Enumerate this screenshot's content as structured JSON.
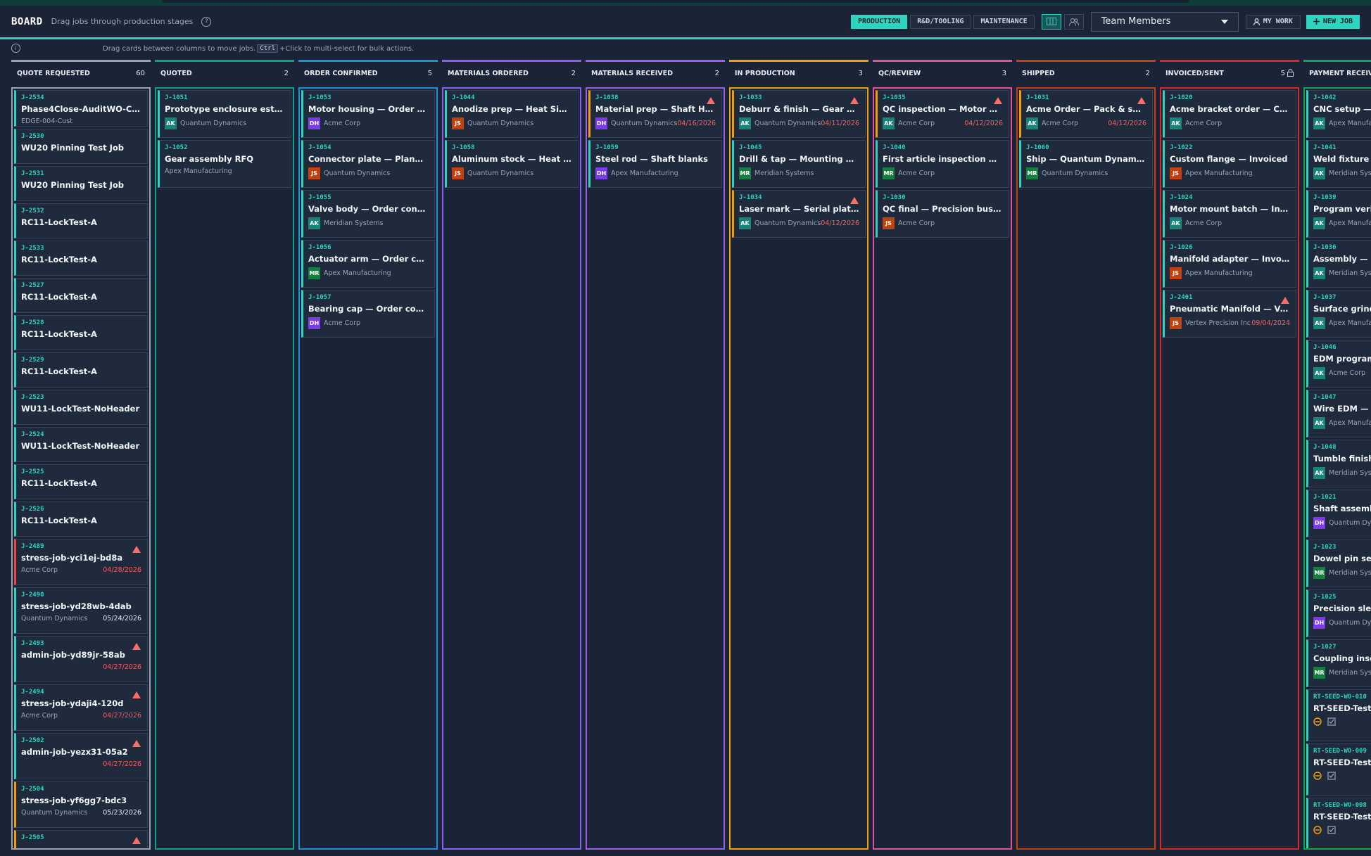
{
  "header": {
    "title": "BOARD",
    "subtitle": "Drag jobs through production stages",
    "help_icon": "question-circle-icon",
    "tabs": [
      {
        "label": "PRODUCTION",
        "active": true
      },
      {
        "label": "R&D/TOOLING",
        "active": false
      },
      {
        "label": "MAINTENANCE",
        "active": false
      }
    ],
    "team_select": "Team Members",
    "my_work": "MY WORK",
    "new_job": "NEW JOB",
    "accent": "#2dd4bf"
  },
  "hint": {
    "before": "Drag cards between columns to move jobs.",
    "key": "Ctrl",
    "after": "+Click to multi-select for bulk actions."
  },
  "avatars": {
    "AK": "#17857a",
    "DH": "#7c3aed",
    "JS": "#c2410c",
    "MR": "#15803d"
  },
  "columns": [
    {
      "title": "QUOTE REQUESTED",
      "count": "60",
      "color": "#9ca3af",
      "cards": [
        {
          "id": "J-2534",
          "title": "Phase4Close-AuditWO-Create",
          "cust": "EDGE-004-Cust",
          "bar": "#2dd4bf"
        },
        {
          "id": "J-2530",
          "title": "WU20 Pinning Test Job",
          "bar": "#2dd4bf"
        },
        {
          "id": "J-2531",
          "title": "WU20 Pinning Test Job",
          "bar": "#2dd4bf"
        },
        {
          "id": "J-2532",
          "title": "RC11-LockTest-A",
          "bar": "#2dd4bf"
        },
        {
          "id": "J-2533",
          "title": "RC11-LockTest-A",
          "bar": "#2dd4bf"
        },
        {
          "id": "J-2527",
          "title": "RC11-LockTest-A",
          "bar": "#2dd4bf"
        },
        {
          "id": "J-2528",
          "title": "RC11-LockTest-A",
          "bar": "#2dd4bf"
        },
        {
          "id": "J-2529",
          "title": "RC11-LockTest-A",
          "bar": "#2dd4bf"
        },
        {
          "id": "J-2523",
          "title": "WU11-LockTest-NoHeader",
          "bar": "#2dd4bf"
        },
        {
          "id": "J-2524",
          "title": "WU11-LockTest-NoHeader",
          "bar": "#2dd4bf"
        },
        {
          "id": "J-2525",
          "title": "RC11-LockTest-A",
          "bar": "#2dd4bf"
        },
        {
          "id": "J-2526",
          "title": "RC11-LockTest-A",
          "bar": "#2dd4bf"
        },
        {
          "id": "J-2489",
          "title": "stress-job-yci1ej-bd8a",
          "cust": "Acme Corp",
          "date": "04/28/2026",
          "overdue": true,
          "warn": true,
          "bar": "#ef4444"
        },
        {
          "id": "J-2490",
          "title": "stress-job-yd28wb-4dab",
          "cust": "Quantum Dynamics",
          "date": "05/24/2026",
          "bar": "#2dd4bf"
        },
        {
          "id": "J-2493",
          "title": "admin-job-yd89jr-58ab",
          "date": "04/27/2026",
          "overdue": true,
          "warn": true,
          "bar": "#2dd4bf"
        },
        {
          "id": "J-2494",
          "title": "stress-job-ydaji4-120d",
          "cust": "Acme Corp",
          "date": "04/27/2026",
          "overdue": true,
          "warn": true,
          "bar": "#2dd4bf"
        },
        {
          "id": "J-2502",
          "title": "admin-job-yezx31-05a2",
          "date": "04/27/2026",
          "overdue": true,
          "warn": true,
          "bar": "#2dd4bf"
        },
        {
          "id": "J-2504",
          "title": "stress-job-yf6gg7-bdc3",
          "cust": "Quantum Dynamics",
          "date": "05/23/2026",
          "bar": "#f59e0b"
        },
        {
          "id": "J-2505",
          "title": "",
          "warn": true,
          "bar": "#f59e0b"
        }
      ]
    },
    {
      "title": "QUOTED",
      "count": "2",
      "color": "#0f9f8a",
      "cards": [
        {
          "id": "J-1051",
          "title": "Prototype enclosure estimate",
          "av": "AK",
          "cust": "Quantum Dynamics",
          "bar": "#2dd4bf"
        },
        {
          "id": "J-1052",
          "title": "Gear assembly RFQ",
          "cust": "Apex Manufacturing",
          "bar": "#2dd4bf"
        }
      ]
    },
    {
      "title": "ORDER CONFIRMED",
      "count": "5",
      "color": "#1e90d8",
      "cards": [
        {
          "id": "J-1053",
          "title": "Motor housing — Order confirmed",
          "av": "DH",
          "cust": "Acme Corp",
          "bar": "#2dd4bf"
        },
        {
          "id": "J-1054",
          "title": "Connector plate — Planning",
          "av": "JS",
          "cust": "Quantum Dynamics",
          "bar": "#2dd4bf"
        },
        {
          "id": "J-1055",
          "title": "Valve body — Order confirmed",
          "av": "AK",
          "cust": "Meridian Systems",
          "bar": "#2dd4bf"
        },
        {
          "id": "J-1056",
          "title": "Actuator arm — Order confirmed",
          "av": "MR",
          "cust": "Apex Manufacturing",
          "bar": "#2dd4bf"
        },
        {
          "id": "J-1057",
          "title": "Bearing cap — Order confirmed",
          "av": "DH",
          "cust": "Acme Corp",
          "bar": "#2dd4bf"
        }
      ]
    },
    {
      "title": "MATERIALS ORDERED",
      "count": "2",
      "color": "#8b5cf6",
      "cards": [
        {
          "id": "J-1044",
          "title": "Anodize prep — Heat Sink Array",
          "av": "JS",
          "cust": "Quantum Dynamics",
          "bar": "#2dd4bf"
        },
        {
          "id": "J-1058",
          "title": "Aluminum stock — Heat Sink",
          "av": "JS",
          "cust": "Quantum Dynamics",
          "bar": "#2dd4bf"
        }
      ]
    },
    {
      "title": "MATERIALS RECEIVED",
      "count": "2",
      "color": "#9b5de5",
      "cards": [
        {
          "id": "J-1038",
          "title": "Material prep — Shaft Housing",
          "av": "DH",
          "cust": "Quantum Dynamics",
          "date": "04/16/2026",
          "overdue": true,
          "warn": true,
          "bar": "#f59e0b"
        },
        {
          "id": "J-1059",
          "title": "Steel rod — Shaft blanks",
          "av": "DH",
          "cust": "Apex Manufacturing",
          "bar": "#2dd4bf"
        }
      ]
    },
    {
      "title": "IN PRODUCTION",
      "count": "3",
      "color": "#f59e0b",
      "cards": [
        {
          "id": "J-1033",
          "title": "Deburr & finish — Gear Blank",
          "av": "AK",
          "cust": "Quantum Dynamics",
          "date": "04/11/2026",
          "overdue": true,
          "warn": true,
          "bar": "#f59e0b"
        },
        {
          "id": "J-1045",
          "title": "Drill & tap — Mounting Block",
          "av": "MR",
          "cust": "Meridian Systems",
          "bar": "#2dd4bf"
        },
        {
          "id": "J-1034",
          "title": "Laser mark — Serial plates (50 pcs)",
          "av": "AK",
          "cust": "Quantum Dynamics",
          "date": "04/12/2026",
          "overdue": true,
          "warn": true,
          "bar": "#f59e0b"
        }
      ]
    },
    {
      "title": "QC/REVIEW",
      "count": "3",
      "color": "#e0509e",
      "cards": [
        {
          "id": "J-1035",
          "title": "QC inspection — Motor Mount Bracket",
          "av": "AK",
          "cust": "Acme Corp",
          "date": "04/12/2026",
          "overdue": true,
          "warn": true,
          "bar": "#f59e0b"
        },
        {
          "id": "J-1040",
          "title": "First article inspection — Flange",
          "av": "MR",
          "cust": "Acme Corp",
          "bar": "#2dd4bf"
        },
        {
          "id": "J-1030",
          "title": "QC final — Precision bushing",
          "av": "JS",
          "cust": "Acme Corp",
          "bar": "#2dd4bf"
        }
      ]
    },
    {
      "title": "SHIPPED",
      "count": "2",
      "color": "#c2410c",
      "cards": [
        {
          "id": "J-1031",
          "title": "Acme Order — Pack & ship",
          "av": "AK",
          "cust": "Acme Corp",
          "date": "04/12/2026",
          "overdue": true,
          "warn": true,
          "bar": "#f59e0b"
        },
        {
          "id": "J-1060",
          "title": "Ship — Quantum Dynamics order",
          "av": "MR",
          "cust": "Quantum Dynamics",
          "bar": "#2dd4bf"
        }
      ]
    },
    {
      "title": "INVOICED/SENT",
      "count": "5",
      "lock": true,
      "color": "#dc2626",
      "cards": [
        {
          "id": "J-1020",
          "title": "Acme bracket order — Complete",
          "av": "AK",
          "cust": "Acme Corp",
          "bar": "#2dd4bf"
        },
        {
          "id": "J-1022",
          "title": "Custom flange — Invoiced",
          "av": "JS",
          "cust": "Apex Manufacturing",
          "bar": "#2dd4bf"
        },
        {
          "id": "J-1024",
          "title": "Motor mount batch — Invoiced",
          "av": "AK",
          "cust": "Acme Corp",
          "bar": "#2dd4bf"
        },
        {
          "id": "J-1026",
          "title": "Manifold adapter — Invoiced",
          "av": "JS",
          "cust": "Apex Manufacturing",
          "bar": "#2dd4bf"
        },
        {
          "id": "J-2401",
          "title": "Pneumatic Manifold — Vertex Precision",
          "av": "JS",
          "cust": "Vertex Precision Inc",
          "date": "09/04/2024",
          "overdue": true,
          "warn": true,
          "bar": "#2dd4bf"
        }
      ]
    },
    {
      "title": "PAYMENT RECEIVED",
      "count": "",
      "color": "#16a34a",
      "cards": [
        {
          "id": "J-1042",
          "title": "CNC setup — Bracket",
          "av": "AK",
          "cust": "Apex Manufacturing",
          "bar": "#2dd4bf"
        },
        {
          "id": "J-1041",
          "title": "Weld fixture alignment",
          "av": "AK",
          "cust": "Meridian Systems",
          "bar": "#2dd4bf"
        },
        {
          "id": "J-1039",
          "title": "Program verify",
          "av": "AK",
          "cust": "Apex Manufacturing",
          "bar": "#2dd4bf"
        },
        {
          "id": "J-1036",
          "title": "Assembly — Pneumatic",
          "av": "AK",
          "cust": "Meridian Systems",
          "bar": "#2dd4bf"
        },
        {
          "id": "J-1037",
          "title": "Surface grind",
          "av": "AK",
          "cust": "Apex Manufacturing",
          "bar": "#2dd4bf"
        },
        {
          "id": "J-1046",
          "title": "EDM programming",
          "av": "AK",
          "cust": "Acme Corp",
          "bar": "#2dd4bf"
        },
        {
          "id": "J-1047",
          "title": "Wire EDM — Punch",
          "av": "AK",
          "cust": "Apex Manufacturing",
          "bar": "#2dd4bf"
        },
        {
          "id": "J-1048",
          "title": "Tumble finish",
          "av": "AK",
          "cust": "Meridian Systems",
          "bar": "#2dd4bf"
        },
        {
          "id": "J-1021",
          "title": "Shaft assembly",
          "av": "DH",
          "cust": "Quantum Dynamics",
          "bar": "#2dd4bf"
        },
        {
          "id": "J-1023",
          "title": "Dowel pin set",
          "av": "MR",
          "cust": "Meridian Systems",
          "bar": "#2dd4bf"
        },
        {
          "id": "J-1025",
          "title": "Precision sleeve",
          "av": "DH",
          "cust": "Quantum Dynamics",
          "bar": "#2dd4bf"
        },
        {
          "id": "J-1027",
          "title": "Coupling insert",
          "av": "MR",
          "cust": "Meridian Systems",
          "bar": "#2dd4bf"
        },
        {
          "id": "RT-SEED-WO-010",
          "title": "RT-SEED-Test job",
          "icons": true,
          "bar": "#2dd4bf"
        },
        {
          "id": "RT-SEED-WO-009",
          "title": "RT-SEED-Test job",
          "icons": true,
          "bar": "#2dd4bf"
        },
        {
          "id": "RT-SEED-WO-008",
          "title": "RT-SEED-Test job",
          "icons": true,
          "bar": "#2dd4bf"
        }
      ]
    }
  ]
}
